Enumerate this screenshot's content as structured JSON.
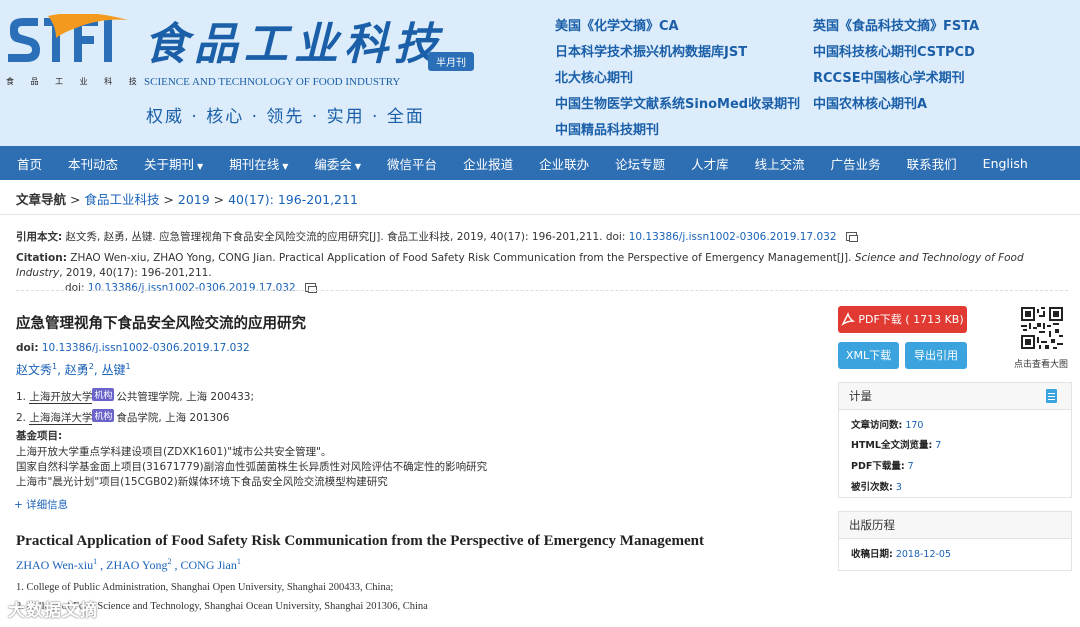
{
  "header": {
    "logo_sub": "食 品 工 业 科 技",
    "title_cn": "食品工业科技",
    "title_en": "SCIENCE AND TECHNOLOGY OF FOOD INDUSTRY",
    "badge": "半月刊",
    "slogan": "权威 · 核心 · 领先 · 实用 · 全面",
    "index_col1": [
      "美国《化学文摘》CA",
      "日本科学技术振兴机构数据库JST",
      "北大核心期刊",
      "中国生物医学文献系统SinoMed收录期刊",
      "中国精品科技期刊"
    ],
    "index_col2": [
      "英国《食品科技文摘》FSTA",
      "中国科技核心期刊CSTPCD",
      "RCCSE中国核心学术期刊",
      "中国农林核心期刊A"
    ]
  },
  "nav": {
    "items": [
      {
        "label": "首页",
        "caret": false
      },
      {
        "label": "本刊动态",
        "caret": false
      },
      {
        "label": "关于期刊",
        "caret": true
      },
      {
        "label": "期刊在线",
        "caret": true
      },
      {
        "label": "编委会",
        "caret": true
      },
      {
        "label": "微信平台",
        "caret": false
      },
      {
        "label": "企业报道",
        "caret": false
      },
      {
        "label": "企业联办",
        "caret": false
      },
      {
        "label": "论坛专题",
        "caret": false
      },
      {
        "label": "人才库",
        "caret": false
      },
      {
        "label": "线上交流",
        "caret": false
      },
      {
        "label": "广告业务",
        "caret": false
      },
      {
        "label": "联系我们",
        "caret": false
      },
      {
        "label": "English",
        "caret": false
      }
    ]
  },
  "breadcrumb": {
    "label": "文章导航",
    "sep": " > ",
    "journal": "食品工业科技",
    "year": "2019",
    "issue": "40(17): 196-201,211"
  },
  "citation": {
    "cn_label": "引用本文:",
    "cn_text": "赵文秀, 赵勇, 丛键. 应急管理视角下食品安全风险交流的应用研究[J]. 食品工业科技, 2019, 40(17): 196-201,211. doi:",
    "doi": "10.13386/j.issn1002-0306.2019.17.032",
    "en_label": "Citation:",
    "en_text": "ZHAO Wen-xiu, ZHAO Yong, CONG Jian. Practical Application of Food Safety Risk Communication from the Perspective of Emergency Management[J].",
    "en_journal": "Science and Technology of Food Industry",
    "en_tail": ", 2019, 40(17): 196-201,211.",
    "en_doi_label": "doi:"
  },
  "article": {
    "title_cn": "应急管理视角下食品安全风险交流的应用研究",
    "doi_label": "doi:",
    "doi": "10.13386/j.issn1002-0306.2019.17.032",
    "authors": [
      {
        "name": "赵文秀",
        "sup": "1",
        "sep": ", "
      },
      {
        "name": "赵勇",
        "sup": "2",
        "sep": ", "
      },
      {
        "name": "丛键",
        "sup": "1",
        "sep": ""
      }
    ],
    "affiliations": [
      {
        "num": "1.",
        "org": "上海开放大学",
        "tag": "机构",
        "rest": "公共管理学院, 上海 200433;"
      },
      {
        "num": "2.",
        "org": "上海海洋大学",
        "tag": "机构",
        "rest": "食品学院, 上海 201306"
      }
    ],
    "fund_title": "基金项目:",
    "funds": [
      "上海开放大学重点学科建设项目(ZDXK1601)\"城市公共安全管理\"。",
      "国家自然科学基金面上项目(31671779)副溶血性弧菌菌株生长异质性对风险评估不确定性的影响研究",
      "上海市\"晨光计划\"项目(15CGB02)新媒体环境下食品安全风险交流模型构建研究"
    ],
    "more": "+ 详细信息",
    "title_en": "Practical Application of Food Safety Risk Communication from the Perspective of Emergency Management",
    "authors_en": [
      {
        "name": "ZHAO Wen-xiu",
        "sup": "1",
        "sep": " ,  "
      },
      {
        "name": "ZHAO Yong",
        "sup": "2",
        "sep": " ,  "
      },
      {
        "name": "CONG Jian",
        "sup": "1",
        "sep": ""
      }
    ],
    "affiliations_en": [
      "1. College of Public Administration, Shanghai Open University, Shanghai 200433, China;",
      "2. College of Food Science and Technology, Shanghai Ocean University, Shanghai 201306, China"
    ]
  },
  "sidebar": {
    "pdf_button": "PDF下载 ( 1713 KB)",
    "xml_button": "XML下载",
    "cite_button": "导出引用",
    "qr_label": "点击查看大图",
    "stats_title": "计量",
    "stats": [
      {
        "label": "文章访问数:",
        "value": "170"
      },
      {
        "label": "HTML全文浏览量:",
        "value": "7"
      },
      {
        "label": "PDF下载量:",
        "value": "7"
      },
      {
        "label": "被引次数:",
        "value": "3"
      }
    ],
    "history_title": "出版历程",
    "history": [
      {
        "label": "收稿日期:",
        "value": "2018-12-05"
      }
    ]
  },
  "watermark": "大数据文摘",
  "colors": {
    "header_bg": "#dcecfa",
    "nav_bg": "#2e6fb3",
    "link": "#1a62b8",
    "pdf_red": "#e03a32",
    "button_blue": "#3ba3dd"
  }
}
